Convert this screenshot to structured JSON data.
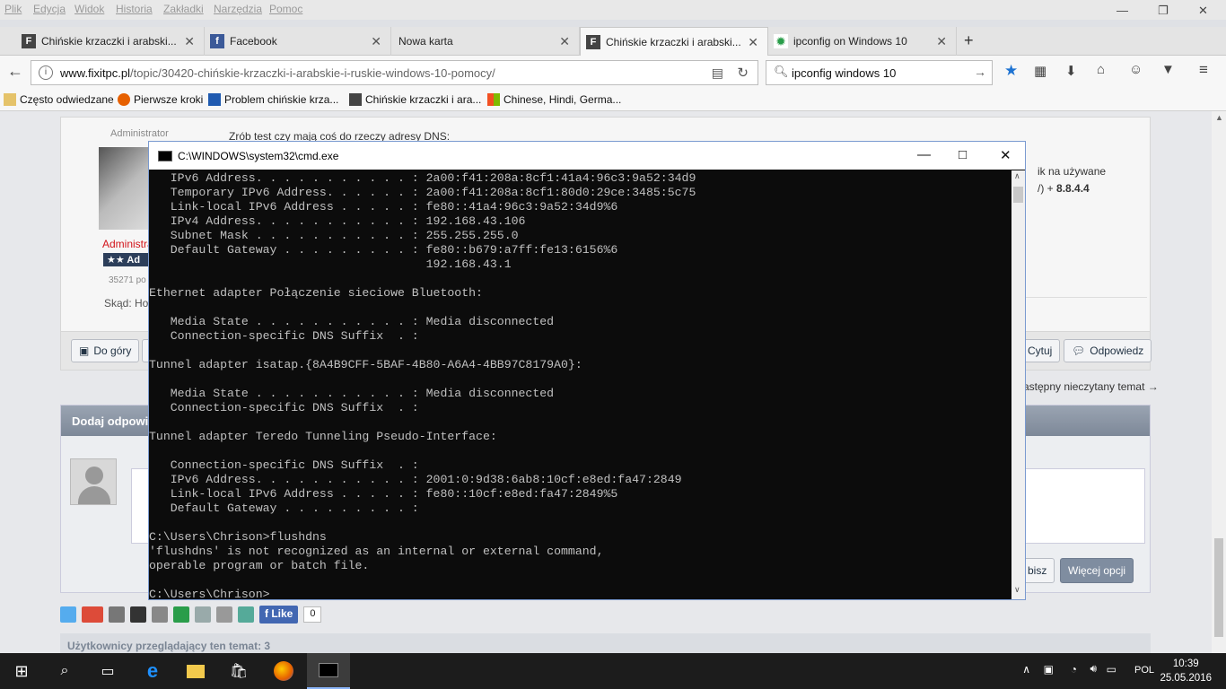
{
  "menubar": {
    "items": [
      "Plik",
      "Edycja",
      "Widok",
      "Historia",
      "Zakładki",
      "Narzędzia",
      "Pomoc"
    ]
  },
  "tabs": [
    {
      "label": "Chińskie krzaczki i arabski...",
      "icon": "site-f-icon",
      "active": false
    },
    {
      "label": "Facebook",
      "icon": "facebook-icon",
      "active": false
    },
    {
      "label": "Nowa karta",
      "icon": "",
      "active": false
    },
    {
      "label": "Chińskie krzaczki i arabski...",
      "icon": "site-f-icon",
      "active": true
    },
    {
      "label": "ipconfig on Windows 10",
      "icon": "loading-icon",
      "active": false
    }
  ],
  "navbar": {
    "url_domain": "www.fixitpc.pl",
    "url_path": "/topic/30420-chińskie-krzaczki-i-arabskie-i-ruskie-windows-10-pomocy/",
    "search_value": "ipconfig windows 10"
  },
  "bookmarks": [
    "Często odwiedzane",
    "Pierwsze kroki",
    "Problem chińskie krza...",
    "Chińskie krzaczki i ara...",
    "Chinese, Hindi, Germa..."
  ],
  "page": {
    "role_label": "Administrator",
    "role_name_red": "Administra",
    "rank_badge": "★★  Ad",
    "post_count": "35271 po",
    "location": "Skąd: Ho",
    "post_line1": "Zrób test czy mają coś do rzeczy adresy DNS:",
    "post_line2": "ik na używane",
    "post_line3_prefix": "/) + ",
    "post_line3_bold": "8.8.4.4",
    "btn_top": "Do góry",
    "btn_quote": "Cytuj",
    "btn_reply": "Odpowiedz",
    "next_unread": "astępny nieczytany temat →",
    "reply_header": "Dodaj odpowi",
    "btn_post": "bisz",
    "btn_more_options": "Więcej opcji",
    "like_label": "Like",
    "like_count": "0",
    "viewers": "Użytkownicy przeglądający ten temat: 3"
  },
  "cmd": {
    "title": "C:\\WINDOWS\\system32\\cmd.exe",
    "lines": [
      "   IPv6 Address. . . . . . . . . . . : 2a00:f41:208a:8cf1:41a4:96c3:9a52:34d9",
      "   Temporary IPv6 Address. . . . . . : 2a00:f41:208a:8cf1:80d0:29ce:3485:5c75",
      "   Link-local IPv6 Address . . . . . : fe80::41a4:96c3:9a52:34d9%6",
      "   IPv4 Address. . . . . . . . . . . : 192.168.43.106",
      "   Subnet Mask . . . . . . . . . . . : 255.255.255.0",
      "   Default Gateway . . . . . . . . . : fe80::b679:a7ff:fe13:6156%6",
      "                                       192.168.43.1",
      "",
      "Ethernet adapter Połączenie sieciowe Bluetooth:",
      "",
      "   Media State . . . . . . . . . . . : Media disconnected",
      "   Connection-specific DNS Suffix  . :",
      "",
      "Tunnel adapter isatap.{8A4B9CFF-5BAF-4B80-A6A4-4BB97C8179A0}:",
      "",
      "   Media State . . . . . . . . . . . : Media disconnected",
      "   Connection-specific DNS Suffix  . :",
      "",
      "Tunnel adapter Teredo Tunneling Pseudo-Interface:",
      "",
      "   Connection-specific DNS Suffix  . :",
      "   IPv6 Address. . . . . . . . . . . : 2001:0:9d38:6ab8:10cf:e8ed:fa47:2849",
      "   Link-local IPv6 Address . . . . . : fe80::10cf:e8ed:fa47:2849%5",
      "   Default Gateway . . . . . . . . . :",
      "",
      "C:\\Users\\Chrison>flushdns",
      "'flushdns' is not recognized as an internal or external command,",
      "operable program or batch file.",
      "",
      "C:\\Users\\Chrison>"
    ]
  },
  "taskbar": {
    "language": "POL",
    "time": "10:39",
    "date": "25.05.2016"
  },
  "colors": {
    "console_bg": "#0c0c0c",
    "console_text": "#c0c0c0",
    "taskbar_bg": "#1c1c1c",
    "accent_blue": "#1e73d2",
    "admin_red": "#d2131a"
  }
}
